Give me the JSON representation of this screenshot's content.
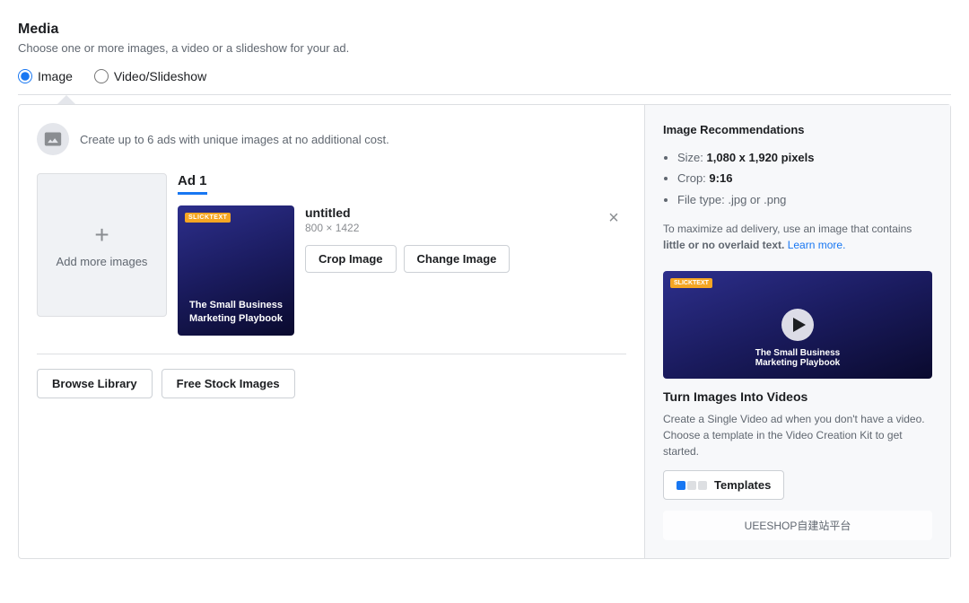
{
  "header": {
    "title": "Media",
    "description": "Choose one or more images, a video or a slideshow for your ad."
  },
  "radio": {
    "image_label": "Image",
    "video_label": "Video/Slideshow"
  },
  "info_banner": {
    "text": "Create up to 6 ads with unique images at no additional cost."
  },
  "add_image": {
    "label": "Add more images"
  },
  "ad_card": {
    "title": "Ad 1",
    "filename": "untitled",
    "dimensions": "800 × 1422",
    "crop_btn": "Crop Image",
    "change_btn": "Change Image",
    "badge": "SLICKTEXT",
    "thumbnail_line1": "The Small Business",
    "thumbnail_line2": "Marketing Playbook"
  },
  "bottom_buttons": {
    "browse": "Browse Library",
    "stock": "Free Stock Images"
  },
  "right_panel": {
    "recommendations_title": "Image Recommendations",
    "rec_items": [
      {
        "label": "Size: ",
        "value": "1,080 x 1,920 pixels",
        "bold": true
      },
      {
        "label": "Crop: ",
        "value": "9:16",
        "bold": true
      },
      {
        "label": "File type: ",
        "value": ".jpg or .png",
        "bold": false
      }
    ],
    "note_text": "To maximize ad delivery, use an image that contains ",
    "note_bold": "little or no overlaid text.",
    "note_link": "Learn more.",
    "video_card_title": "Turn Images Into Videos",
    "video_card_desc": "Create a Single Video ad when you don't have a video. Choose a template in the Video Creation Kit to get started.",
    "templates_btn": "Templates",
    "preview_badge": "SLICKTEXT",
    "preview_line1": "The Sm",
    "preview_line2": "Marketing Playbook"
  },
  "watermark": "UEESHOP自建站平台"
}
